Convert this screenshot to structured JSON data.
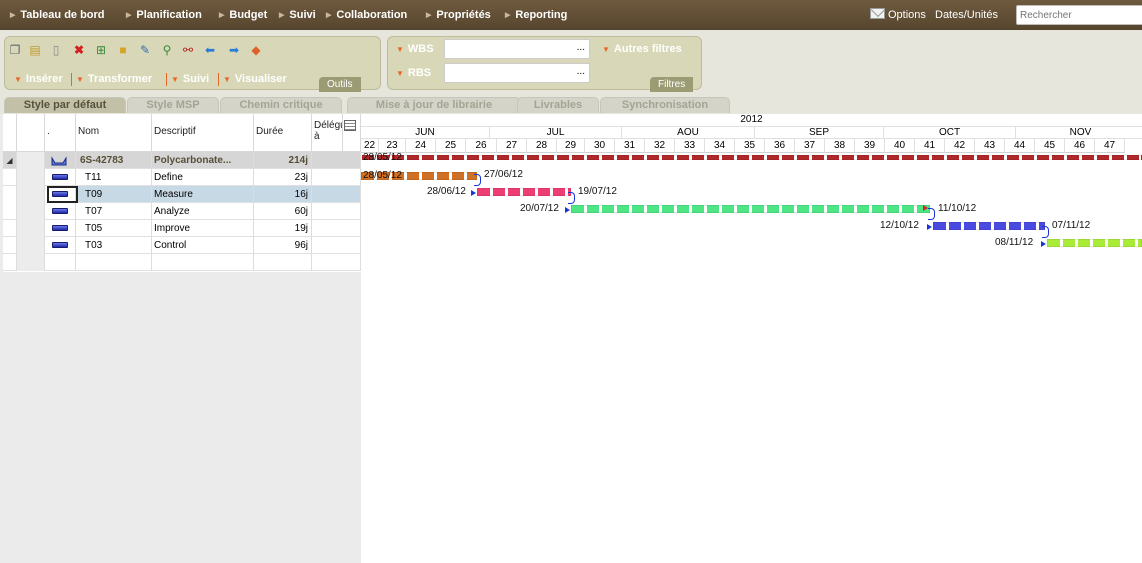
{
  "nav": {
    "items": [
      "Tableau de bord",
      "Planification",
      "Budget",
      "Suivi",
      "Collaboration",
      "Propriétés",
      "Reporting"
    ],
    "options": "Options",
    "dates": "Dates/Unités",
    "search_placeholder": "Rechercher"
  },
  "tools": {
    "buttons": [
      "Insérer",
      "Transformer",
      "Suivi",
      "Visualiser"
    ],
    "label": "Outils",
    "icons": [
      "copy-icon",
      "paste-icon",
      "document-icon",
      "delete-icon",
      "add-row-icon",
      "folder-icon",
      "edit-icon",
      "link-icon",
      "unlink-icon",
      "arrow-left-icon",
      "arrow-right-icon",
      "eraser-icon"
    ]
  },
  "filters": {
    "wbs_label": "WBS",
    "rbs_label": "RBS",
    "wbs_value": "...",
    "rbs_value": "...",
    "other": "Autres filtres",
    "label": "Filtres"
  },
  "tabs": [
    "Style par défaut",
    "Style MSP",
    "Chemin critique",
    "Mise à jour de librairie",
    "Livrables",
    "Synchronisation"
  ],
  "grid": {
    "headers": {
      "dot": ".",
      "name": "Nom",
      "desc": "Descriptif",
      "duration": "Durée",
      "delegate": "Délégué à"
    },
    "summary": {
      "name": "6S-42783",
      "desc": "Polycarbonate...",
      "duration": "214j"
    },
    "rows": [
      {
        "name": "T11",
        "desc": "Define",
        "duration": "23j"
      },
      {
        "name": "T09",
        "desc": "Measure",
        "duration": "16j"
      },
      {
        "name": "T07",
        "desc": "Analyze",
        "duration": "60j"
      },
      {
        "name": "T05",
        "desc": "Improve",
        "duration": "19j"
      },
      {
        "name": "T03",
        "desc": "Control",
        "duration": "96j"
      }
    ]
  },
  "gantt": {
    "year": "2012",
    "months": [
      "JUN",
      "JUL",
      "AOU",
      "SEP",
      "OCT",
      "NOV"
    ],
    "weeks": [
      "22",
      "23",
      "24",
      "25",
      "26",
      "27",
      "28",
      "29",
      "30",
      "31",
      "32",
      "33",
      "34",
      "35",
      "36",
      "37",
      "38",
      "39",
      "40",
      "41",
      "42",
      "43",
      "44",
      "45",
      "46",
      "47"
    ],
    "summary": {
      "start": "28/05/12",
      "color": "#b0282a"
    },
    "tasks": [
      {
        "start": "28/05/12",
        "end": "27/06/12",
        "color": "#d07024"
      },
      {
        "start": "28/06/12",
        "end": "19/07/12",
        "color": "#ee3c74"
      },
      {
        "start": "20/07/12",
        "end": "11/10/12",
        "color": "#4ee684"
      },
      {
        "start": "12/10/12",
        "end": "07/11/12",
        "color": "#4a4ae0"
      },
      {
        "start": "08/11/12",
        "end": "",
        "color": "#a8ec38"
      }
    ]
  }
}
